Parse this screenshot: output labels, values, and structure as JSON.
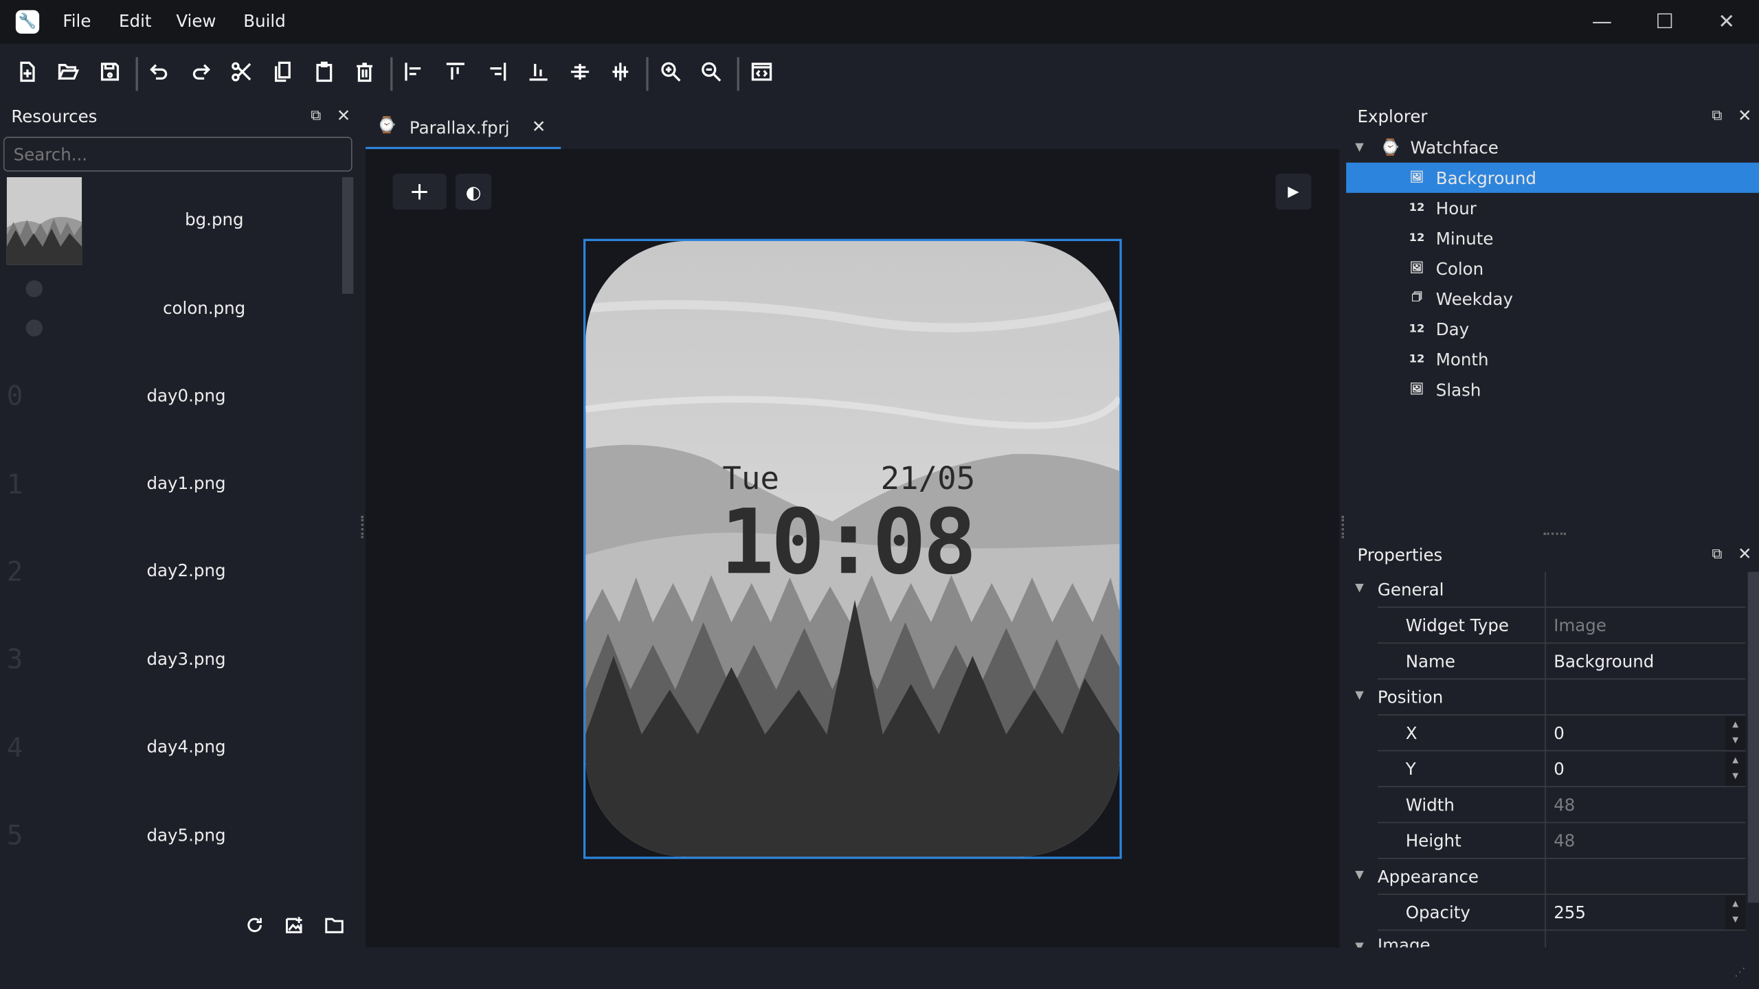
{
  "menu": [
    "File",
    "Edit",
    "View",
    "Build"
  ],
  "window": {
    "minimize": "—",
    "maximize": "☐",
    "close": "✕"
  },
  "toolbar": [
    "new-file",
    "open-folder",
    "save",
    "undo",
    "redo",
    "cut",
    "copy",
    "paste",
    "delete",
    "align-left",
    "align-top",
    "align-right",
    "align-bottom",
    "align-vcenter",
    "align-hcenter",
    "zoom-in",
    "zoom-out",
    "code-view"
  ],
  "resources": {
    "title": "Resources",
    "search_placeholder": "Search...",
    "items": [
      {
        "name": "bg.png",
        "thumb": ""
      },
      {
        "name": "colon.png",
        "thumb": ""
      },
      {
        "name": "day0.png",
        "thumb": "0"
      },
      {
        "name": "day1.png",
        "thumb": "1"
      },
      {
        "name": "day2.png",
        "thumb": "2"
      },
      {
        "name": "day3.png",
        "thumb": "3"
      },
      {
        "name": "day4.png",
        "thumb": "4"
      },
      {
        "name": "day5.png",
        "thumb": "5"
      }
    ]
  },
  "tab": {
    "label": "Parallax.fprj",
    "close": "✕"
  },
  "preview": {
    "weekday": "Tue",
    "date": "21/05",
    "time": "10:08"
  },
  "explorer": {
    "title": "Explorer",
    "root": "Watchface",
    "items": [
      {
        "label": "Background",
        "icon": "image-icon",
        "selected": true
      },
      {
        "label": "Hour",
        "icon": "number-icon"
      },
      {
        "label": "Minute",
        "icon": "number-icon"
      },
      {
        "label": "Colon",
        "icon": "image-icon"
      },
      {
        "label": "Weekday",
        "icon": "image-list-icon"
      },
      {
        "label": "Day",
        "icon": "number-icon"
      },
      {
        "label": "Month",
        "icon": "number-icon"
      },
      {
        "label": "Slash",
        "icon": "image-icon"
      }
    ]
  },
  "properties": {
    "title": "Properties",
    "general": "General",
    "widget_type_label": "Widget Type",
    "widget_type": "Image",
    "name_label": "Name",
    "name": "Background",
    "position": "Position",
    "x_label": "X",
    "x": "0",
    "y_label": "Y",
    "y": "0",
    "width_label": "Width",
    "width": "48",
    "height_label": "Height",
    "height": "48",
    "appearance": "Appearance",
    "opacity_label": "Opacity",
    "opacity": "255",
    "image": "Image"
  },
  "colors": {
    "accent": "#2d84dc",
    "selection": "#2d84dc"
  }
}
